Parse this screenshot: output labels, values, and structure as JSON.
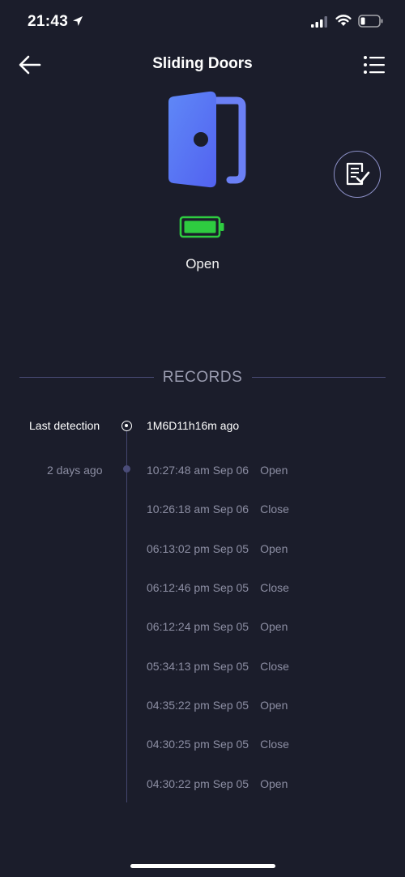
{
  "status_bar": {
    "time": "21:43",
    "icons": [
      "location-arrow-icon",
      "cellular-signal-icon",
      "wifi-icon",
      "battery-icon"
    ]
  },
  "header": {
    "title": "Sliding Doors",
    "back_icon": "arrow-left-icon",
    "menu_icon": "list-menu-icon"
  },
  "device": {
    "icon": "door-open-icon",
    "battery_icon": "battery-full-icon",
    "battery_color": "#2ecc40",
    "accent_color": "#5b6cf5",
    "state": "Open",
    "report_icon": "report-check-icon"
  },
  "records": {
    "title": "RECORDS",
    "last_detection": {
      "label": "Last detection",
      "value": "1M6D11h16m ago"
    },
    "groups": [
      {
        "label": "2 days ago",
        "items": [
          {
            "time": "10:27:48 am Sep 06",
            "state": "Open"
          },
          {
            "time": "10:26:18 am Sep 06",
            "state": "Close"
          },
          {
            "time": "06:13:02 pm Sep 05",
            "state": "Open"
          },
          {
            "time": "06:12:46 pm Sep 05",
            "state": "Close"
          },
          {
            "time": "06:12:24 pm Sep 05",
            "state": "Open"
          },
          {
            "time": "05:34:13 pm Sep 05",
            "state": "Close"
          },
          {
            "time": "04:35:22 pm Sep 05",
            "state": "Open"
          },
          {
            "time": "04:30:25 pm Sep 05",
            "state": "Close"
          },
          {
            "time": "04:30:22 pm Sep 05",
            "state": "Open"
          }
        ]
      }
    ]
  }
}
